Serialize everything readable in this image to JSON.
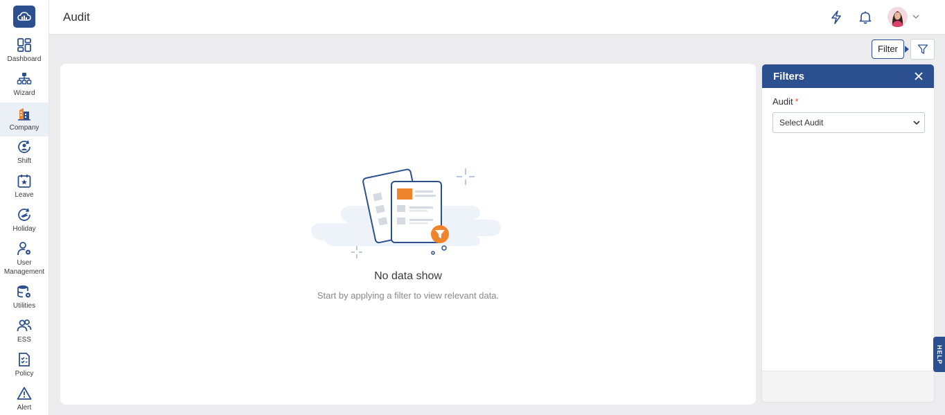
{
  "sidebar": {
    "items": [
      {
        "label": "Dashboard",
        "icon": "dashboard-icon"
      },
      {
        "label": "Wizard",
        "icon": "wizard-icon"
      },
      {
        "label": "Company",
        "icon": "company-icon",
        "active": true
      },
      {
        "label": "Shift",
        "icon": "shift-icon"
      },
      {
        "label": "Leave",
        "icon": "leave-icon"
      },
      {
        "label": "Holiday",
        "icon": "holiday-icon"
      },
      {
        "label": "User\nManagement",
        "icon": "user-management-icon"
      },
      {
        "label": "Utilities",
        "icon": "utilities-icon"
      },
      {
        "label": "ESS",
        "icon": "ess-icon"
      },
      {
        "label": "Policy",
        "icon": "policy-icon"
      },
      {
        "label": "Alert",
        "icon": "alert-icon"
      }
    ]
  },
  "header": {
    "title": "Audit"
  },
  "toolbar": {
    "filter_tooltip": "Filter"
  },
  "empty_state": {
    "title": "No data show",
    "subtitle": "Start by applying a filter to view relevant data."
  },
  "filters": {
    "title": "Filters",
    "audit_label": "Audit",
    "required_mark": "*",
    "audit_select_value": "Select Audit"
  },
  "help_tab": "HELP",
  "colors": {
    "brand": "#2b4f8f",
    "accent": "#f0842a",
    "active_bg": "#ebeff6"
  }
}
